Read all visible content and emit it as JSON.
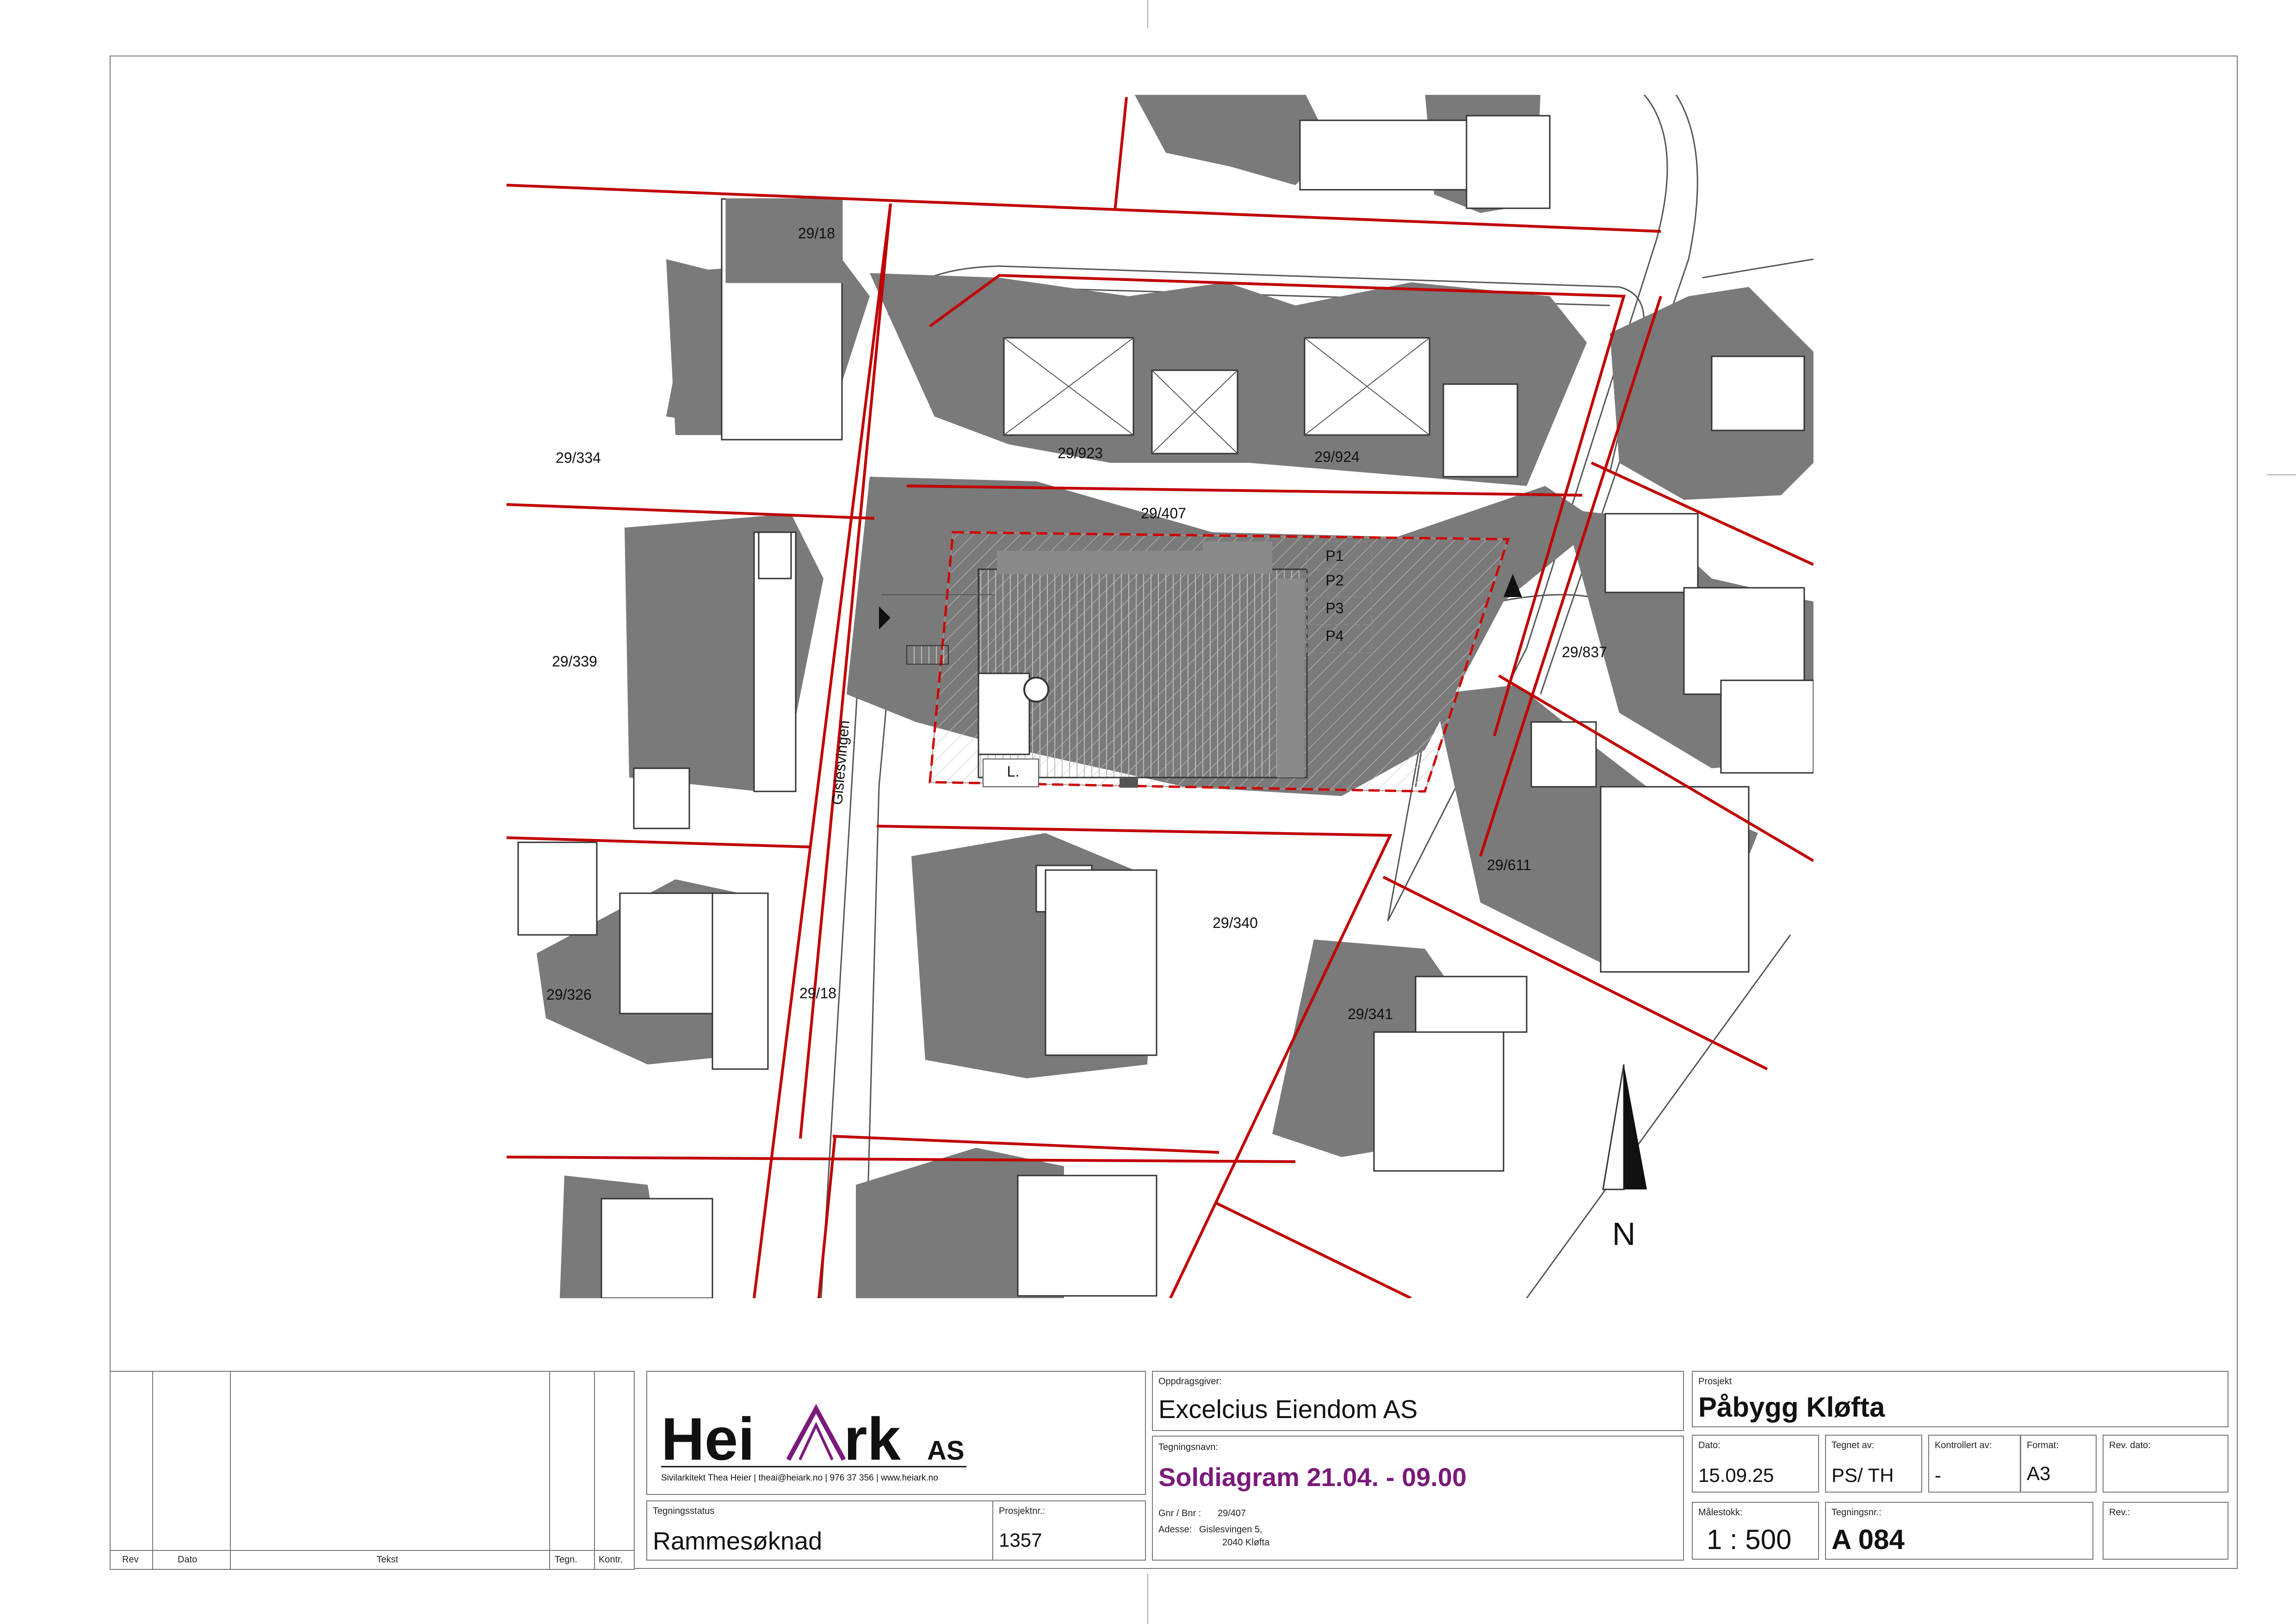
{
  "parcels": [
    "29/18",
    "29/334",
    "29/923",
    "29/924",
    "29/407",
    "29/339",
    "29/837",
    "29/340",
    "29/611",
    "29/326",
    "29/18",
    "29/341"
  ],
  "road_name": "Gislesvingen",
  "parking": [
    "P1",
    "P2",
    "P3",
    "P4"
  ],
  "site_marker": "L.",
  "north": "N",
  "colors": {
    "boundary": "#c00000",
    "shadow": "#7a7a7a",
    "project_line": "#d00000",
    "title_accent": "#7a1a7a"
  },
  "revision_table": {
    "headers": {
      "rev": "Rev",
      "dato": "Dato",
      "tekst": "Tekst",
      "tegn": "Tegn.",
      "kontr": "Kontr."
    }
  },
  "logo": {
    "name_a": "Hei",
    "name_b": "rk",
    "suffix": "AS",
    "tagline": "Sivilarkitekt Thea Heier | theai@heiark.no | 976 37 356 | www.heiark.no"
  },
  "status": {
    "label": "Tegningsstatus",
    "value": "Rammesøknad"
  },
  "project_no": {
    "label": "Prosjektnr.:",
    "value": "1357"
  },
  "client": {
    "label": "Oppdragsgiver:",
    "value": "Excelcius Eiendom AS"
  },
  "drawing_name": {
    "label": "Tegningsnavn:",
    "value": "Soldiagram 21.04. - 09.00"
  },
  "gnr": {
    "label": "Gnr / Bnr :",
    "value": "29/407"
  },
  "address": {
    "label": "Adesse:",
    "line1": "Gislesvingen 5,",
    "line2": "2040 Kløfta"
  },
  "project": {
    "label": "Prosjekt",
    "value": "Påbygg Kløfta"
  },
  "date": {
    "label": "Dato:",
    "value": "15.09.25"
  },
  "drawn_by": {
    "label": "Tegnet av:",
    "value": "PS/ TH"
  },
  "checked_by": {
    "label": "Kontrollert av:",
    "value": "-"
  },
  "format": {
    "label": "Format:",
    "value": "A3"
  },
  "rev_date": {
    "label": "Rev. dato:",
    "value": ""
  },
  "scale": {
    "label": "Målestokk:",
    "value": "1 : 500"
  },
  "drawing_no": {
    "label": "Tegningsnr.:",
    "value": "A 084"
  },
  "rev": {
    "label": "Rev.:",
    "value": ""
  }
}
